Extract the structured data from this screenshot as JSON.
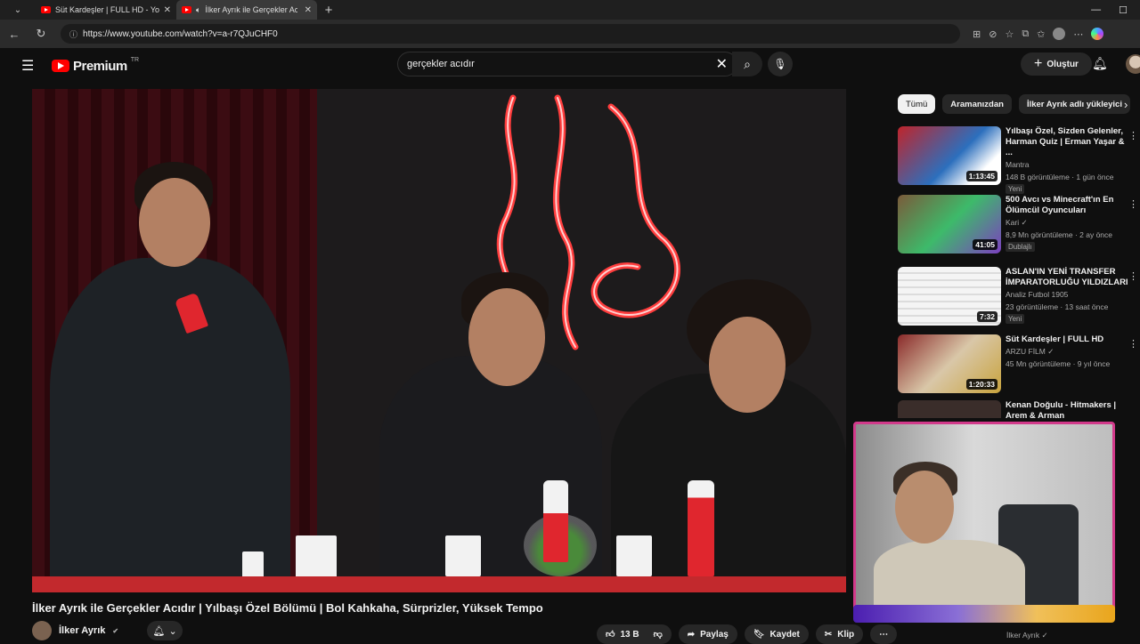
{
  "browser": {
    "tabs": [
      {
        "title": "Süt Kardeşler | FULL HD - YouTube"
      },
      {
        "title": "İlker Ayrık ile Gerçekler Acıdır"
      }
    ],
    "url": "https://www.youtube.com/watch?v=a-r7QJuCHF0"
  },
  "youtube": {
    "logo_text": "Premium",
    "country_code": "TR",
    "search_value": "gerçekler acıdır",
    "create_label": "Oluştur"
  },
  "video": {
    "title": "İlker Ayrık ile Gerçekler Acıdır | Yılbaşı Özel Bölümü | Bol Kahkaha, Sürprizler, Yüksek Tempo",
    "channel": "İlker Ayrık",
    "like_count": "13 B",
    "share_label": "Paylaş",
    "save_label": "Kaydet",
    "clip_label": "Klip"
  },
  "sidebar": {
    "chips": [
      "Tümü",
      "Aramanızdan",
      "İlker Ayrık adlı yükleyici"
    ],
    "recommendations": [
      {
        "title": "Yılbaşı Özel, Sizden Gelenler, Harman Quiz | Erman Yaşar & ...",
        "channel": "Mantra",
        "views": "148 B görüntüleme · 1 gün önce",
        "badge": "Yeni",
        "duration": "1:13:45"
      },
      {
        "title": "500 Avcı vs Minecraft'ın En Ölümcül Oyuncuları",
        "channel": "Kari ✓",
        "views": "8,9 Mn görüntüleme · 2 ay önce",
        "badge": "Dublajlı",
        "duration": "41:05"
      },
      {
        "title": "ASLAN'IN YENİ TRANSFER İMPARATORLUĞU YILDIZLARI",
        "channel": "Analiz Futbol 1905",
        "views": "23 görüntüleme · 13 saat önce",
        "badge": "Yeni",
        "duration": "7:32"
      },
      {
        "title": "Süt Kardeşler | FULL HD",
        "channel": "ARZU FİLM ✓",
        "views": "45 Mn görüntüleme · 9 yıl önce",
        "badge": "",
        "duration": "1:20:33"
      },
      {
        "title": "Kenan Doğulu - Hitmakers | Arem & Arman",
        "channel": "",
        "views": "",
        "badge": "",
        "duration": ""
      }
    ],
    "last_visible_channel": "İlker Ayrık ✓"
  },
  "colors": {
    "accent": "#ff0000",
    "bg": "#0f0f0f",
    "surface": "#272727"
  }
}
